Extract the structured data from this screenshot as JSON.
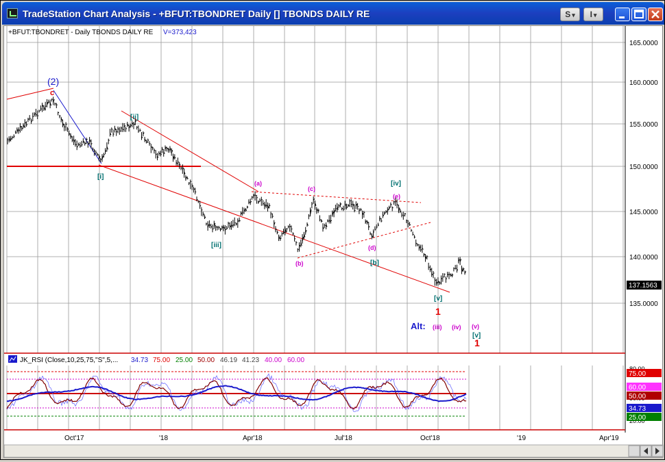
{
  "window": {
    "title": "TradeStation Chart Analysis - +BFUT:TBONDRET Daily [] TBONDS DAILY RE",
    "btn_s": "S",
    "btn_i": "I",
    "dropdown_arrow": "▾"
  },
  "header": {
    "symbol": "+BFUT:TBONDRET - Daily  TBONDS DAILY RE",
    "volume": "V=373,423"
  },
  "price_axis": {
    "ticks": [
      "165.0000",
      "160.0000",
      "155.0000",
      "150.0000",
      "145.0000",
      "140.0000",
      "135.0000"
    ],
    "last_price": "137.1563"
  },
  "time_axis": {
    "ticks": [
      "Oct'17",
      "'18",
      "Apr'18",
      "Jul'18",
      "Oct'18",
      "'19",
      "Apr'19"
    ]
  },
  "wave_labels": [
    {
      "text": "(2)",
      "color": "#1a1acc"
    },
    {
      "text": "c",
      "color": "#e00000"
    },
    {
      "text": "[ii]",
      "color": "#007070"
    },
    {
      "text": "[i]",
      "color": "#007070"
    },
    {
      "text": "[iii]",
      "color": "#007070"
    },
    {
      "text": "(a)",
      "color": "#cc00cc"
    },
    {
      "text": "(c)",
      "color": "#cc00cc"
    },
    {
      "text": "[iv]",
      "color": "#007070"
    },
    {
      "text": "(e)",
      "color": "#cc00cc"
    },
    {
      "text": "(d)",
      "color": "#cc00cc"
    },
    {
      "text": "[b]",
      "color": "#007070"
    },
    {
      "text": "(b)",
      "color": "#cc00cc"
    },
    {
      "text": "[v]",
      "color": "#007070"
    },
    {
      "text": "1",
      "color": "#e00000"
    },
    {
      "text": "Alt:",
      "color": "#1a1acc"
    },
    {
      "text": "(iii)",
      "color": "#cc00cc"
    },
    {
      "text": "(iv)",
      "color": "#cc00cc"
    },
    {
      "text": "(v)",
      "color": "#cc00cc"
    },
    {
      "text": "[v]",
      "color": "#007070"
    },
    {
      "text": "1",
      "color": "#e00000"
    }
  ],
  "indicator": {
    "name": "JK_RSI (Close,10,25,75,\"S\",5,...",
    "values": [
      {
        "text": "34.73",
        "color": "#1a1acc"
      },
      {
        "text": "75.00",
        "color": "#e00000"
      },
      {
        "text": "25.00",
        "color": "#008000"
      },
      {
        "text": "50.00",
        "color": "#a00000"
      },
      {
        "text": "46.19",
        "color": "#444444"
      },
      {
        "text": "41.23",
        "color": "#444444"
      },
      {
        "text": "40.00",
        "color": "#cc00cc"
      },
      {
        "text": "60.00",
        "color": "#cc00cc"
      }
    ],
    "axis_ticks": [
      "80.00",
      "75.00",
      "60.00",
      "50.00",
      "40.00",
      "34.73",
      "25.00",
      "20.00"
    ],
    "badges": [
      {
        "text": "75.00",
        "bg": "#e00000",
        "fg": "#ffffff"
      },
      {
        "text": "60.00",
        "bg": "#ff33ff",
        "fg": "#ffffff"
      },
      {
        "text": "50.00",
        "bg": "#b00000",
        "fg": "#ffffff"
      },
      {
        "text": "34.73",
        "bg": "#1a1acc",
        "fg": "#ffffff"
      },
      {
        "text": "25.00",
        "bg": "#008000",
        "fg": "#ffffff"
      }
    ]
  }
}
